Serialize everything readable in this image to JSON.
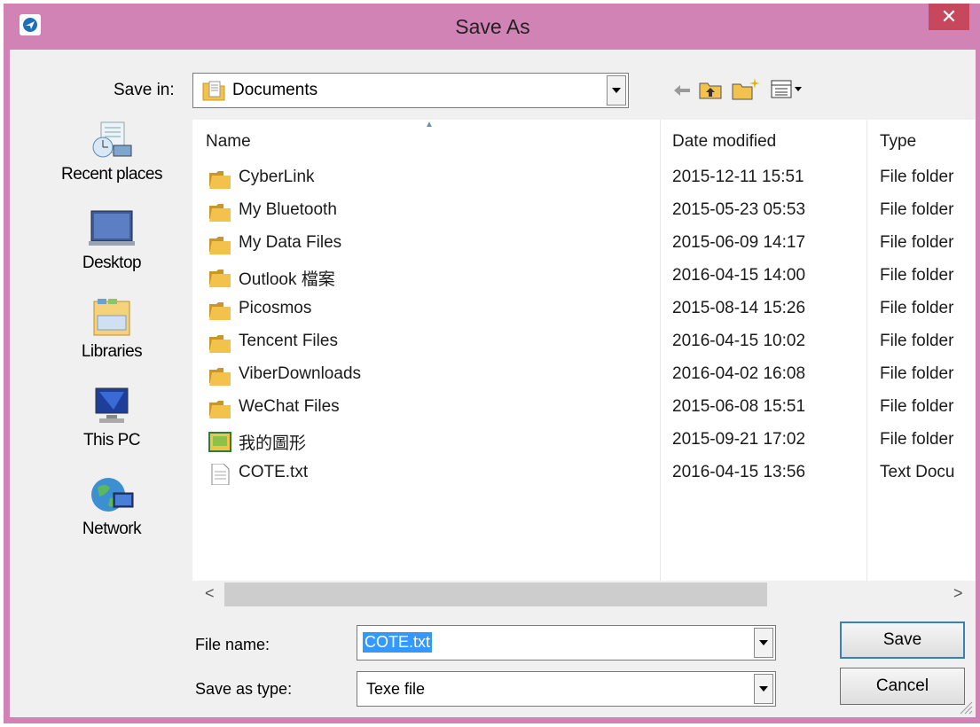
{
  "window": {
    "title": "Save As",
    "close_glyph": "✕",
    "app_icon": "dialog-app-icon"
  },
  "save_in": {
    "label": "Save in:",
    "value": "Documents"
  },
  "toolbar": {
    "icons": [
      "back-arrow-icon",
      "up-one-level-icon",
      "new-folder-icon",
      "view-menu-icon"
    ]
  },
  "places": [
    {
      "label": "Recent places",
      "icon": "recent-places-icon"
    },
    {
      "label": "Desktop",
      "icon": "desktop-icon"
    },
    {
      "label": "Libraries",
      "icon": "libraries-icon"
    },
    {
      "label": "This PC",
      "icon": "this-pc-icon"
    },
    {
      "label": "Network",
      "icon": "network-icon"
    }
  ],
  "columns": {
    "name": "Name",
    "date": "Date modified",
    "type": "Type",
    "sort_glyph": "▲"
  },
  "files": [
    {
      "name": "CyberLink",
      "date": "2015-12-11 15:51",
      "type": "File folder",
      "icon": "folder-icon"
    },
    {
      "name": "My Bluetooth",
      "date": "2015-05-23 05:53",
      "type": "File folder",
      "icon": "folder-icon"
    },
    {
      "name": "My Data Files",
      "date": "2015-06-09 14:17",
      "type": "File folder",
      "icon": "folder-icon"
    },
    {
      "name": "Outlook 檔案",
      "date": "2016-04-15 14:00",
      "type": "File folder",
      "icon": "folder-icon"
    },
    {
      "name": "Picosmos",
      "date": "2015-08-14 15:26",
      "type": "File folder",
      "icon": "folder-icon"
    },
    {
      "name": "Tencent Files",
      "date": "2016-04-15 10:02",
      "type": "File folder",
      "icon": "folder-icon"
    },
    {
      "name": "ViberDownloads",
      "date": "2016-04-02 16:08",
      "type": "File folder",
      "icon": "folder-icon"
    },
    {
      "name": "WeChat Files",
      "date": "2015-06-08 15:51",
      "type": "File folder",
      "icon": "folder-icon"
    },
    {
      "name": "我的圖形",
      "date": "2015-09-21 17:02",
      "type": "File folder",
      "icon": "pictures-folder-icon"
    },
    {
      "name": "COTE.txt",
      "date": "2016-04-15 13:56",
      "type": "Text Docu",
      "icon": "text-file-icon"
    }
  ],
  "scrollbar": {
    "left_glyph": "<",
    "right_glyph": ">"
  },
  "file_name": {
    "label": "File name:",
    "value": "COTE.txt"
  },
  "save_as_type": {
    "label": "Save as type:",
    "value": "Texe file"
  },
  "buttons": {
    "save": "Save",
    "cancel": "Cancel"
  },
  "colors": {
    "frame": "#d283b5",
    "close": "#c7485d",
    "selection": "#3399ff",
    "folder": "#f2c24c"
  }
}
